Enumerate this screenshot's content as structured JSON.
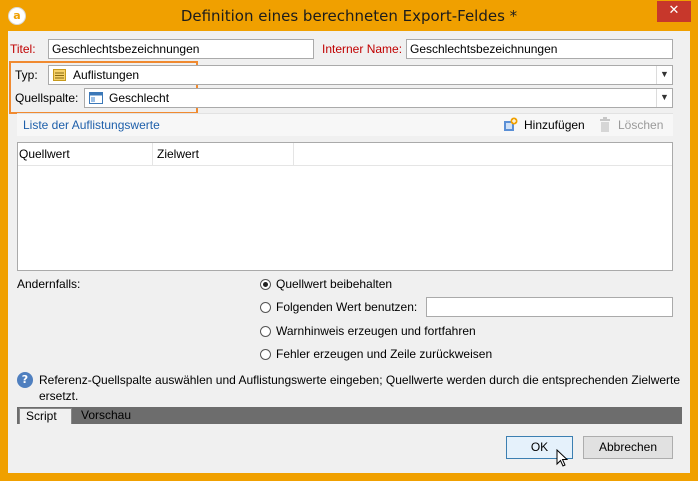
{
  "window": {
    "title": "Definition eines berechneten Export-Feldes *",
    "app_icon_glyph": "a",
    "close_glyph": "✕"
  },
  "form": {
    "titel_label": "Titel:",
    "titel_value": "Geschlechtsbezeichnungen",
    "interner_name_label": "Interner Name:",
    "interner_name_value": "Geschlechtsbezeichnungen",
    "typ_label": "Typ:",
    "typ_value": "Auflistungen",
    "quellspalte_label": "Quellspalte:",
    "quellspalte_value": "Geschlecht"
  },
  "list_section": {
    "link_label": "Liste der Auflistungswerte",
    "add_label": "Hinzufügen",
    "delete_label": "Löschen",
    "columns": [
      "Quellwert",
      "Zielwert"
    ]
  },
  "otherwise": {
    "label": "Andernfalls:",
    "options": [
      {
        "label": "Quellwert beibehalten",
        "selected": true
      },
      {
        "label": "Folgenden Wert benutzen:",
        "selected": false
      },
      {
        "label": "Warnhinweis erzeugen und fortfahren",
        "selected": false
      },
      {
        "label": "Fehler erzeugen und Zeile zurückweisen",
        "selected": false
      }
    ],
    "value_input": ""
  },
  "info": {
    "text_line1": "Referenz-Quellspalte auswählen und Auflistungswerte eingeben; Quellwerte werden durch die entsprechenden Zielwerte",
    "text_line2": "ersetzt."
  },
  "tabs": [
    {
      "label": "Script",
      "active": true
    },
    {
      "label": "Vorschau",
      "active": false
    }
  ],
  "buttons": {
    "ok": "OK",
    "cancel": "Abbrechen"
  },
  "colors": {
    "accent": "#f0a000",
    "highlight": "#f08a30",
    "link": "#1e5faa",
    "required_label": "#c00000"
  }
}
